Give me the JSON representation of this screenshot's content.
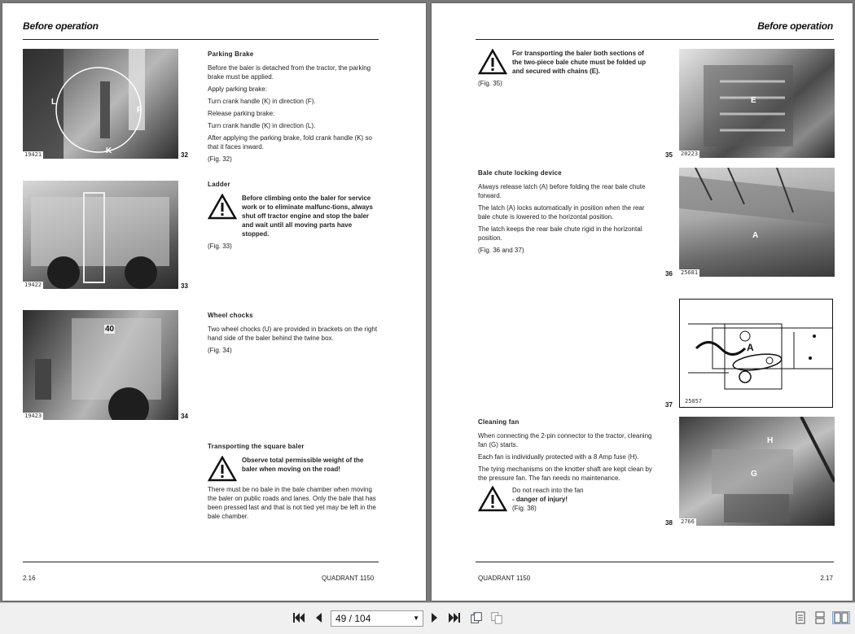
{
  "left_page": {
    "header": "Before operation",
    "footer_left": "2.16",
    "footer_right": "QUADRANT 1150",
    "figures": [
      {
        "number": "32",
        "code": "19421",
        "labels": {
          "l": "L",
          "f": "F",
          "k": "K"
        }
      },
      {
        "number": "33",
        "code": "19422"
      },
      {
        "number": "34",
        "code": "19423",
        "labels": {
          "num": "40"
        }
      }
    ],
    "parking": {
      "title": "Parking Brake",
      "p1": "Before the baler is detached from the tractor, the parking brake must be applied.",
      "p2": "Apply parking brake:",
      "p3": "Turn crank handle (K) in direction (F).",
      "p4": "Release parking brake:",
      "p5": "Turn crank handle (K) in direction (L).",
      "p6": "After applying the parking brake, fold crank handle (K) so that it faces inward.",
      "ref": "(Fig. 32)"
    },
    "ladder": {
      "title": "Ladder",
      "warning": "Before climbing onto the baler for service work or to eliminate malfunc-tions, always shut off tractor engine and stop the baler and wait until all moving parts have stopped.",
      "ref": "(Fig. 33)"
    },
    "chocks": {
      "title": "Wheel chocks",
      "p1": "Two wheel chocks (U) are provided in brackets on the right hand side of the baler behind the twine box.",
      "ref": "(Fig. 34)"
    },
    "transport": {
      "title": "Transporting the square baler",
      "warning": "Observe total permissible weight of the baler when moving on the road!",
      "p1": "There must be no bale in the bale chamber when moving the baler on public roads and lanes. Only the bale that has been pressed last and that is not tied yet may be left in the bale chamber."
    }
  },
  "right_page": {
    "header": "Before operation",
    "footer_left": "QUADRANT 1150",
    "footer_right": "2.17",
    "figures": [
      {
        "number": "35",
        "code": "20223",
        "labels": {
          "e": "E"
        }
      },
      {
        "number": "36",
        "code": "25681",
        "labels": {
          "a": "A"
        }
      },
      {
        "number": "37",
        "code": "25057",
        "labels": {
          "a": "A"
        }
      },
      {
        "number": "38",
        "code": "2766",
        "labels": {
          "h": "H",
          "g": "G"
        }
      }
    ],
    "chute": {
      "warning": "For transporting the baler both sections of the two-piece bale chute must be folded up and secured with chains (E).",
      "ref": "(Fig. 35)"
    },
    "locking": {
      "title": "Bale chute locking device",
      "p1": "Always release latch (A) before folding the rear bale chute forward.",
      "p2": "The latch (A) locks automatically in position when the rear bale chute is lowered to the horizontal position.",
      "p3": "The latch keeps the rear bale chute rigid in the horizontal position.",
      "ref": "(Fig. 36 and 37)"
    },
    "fan": {
      "title": "Cleaning fan",
      "p1": "When connecting the 2-pin connector to the tractor, cleaning fan (G) starts.",
      "p2": "Each fan is individually protected with a 8 Amp fuse (H).",
      "p3": "The tying mechanisms on the knotter shaft are kept clean by the pressure fan. The fan needs no maintenance.",
      "warning_line1": "Do not reach into the fan",
      "warning_line2": "- danger of injury!",
      "ref": "(Fig. 38)"
    }
  },
  "toolbar": {
    "page_indicator": "49 / 104",
    "icons": [
      "first-page-icon",
      "prev-page-icon",
      "next-page-icon",
      "last-page-icon",
      "rotate-icon",
      "copy-icon",
      "single-page-icon",
      "continuous-icon",
      "two-page-icon"
    ]
  }
}
